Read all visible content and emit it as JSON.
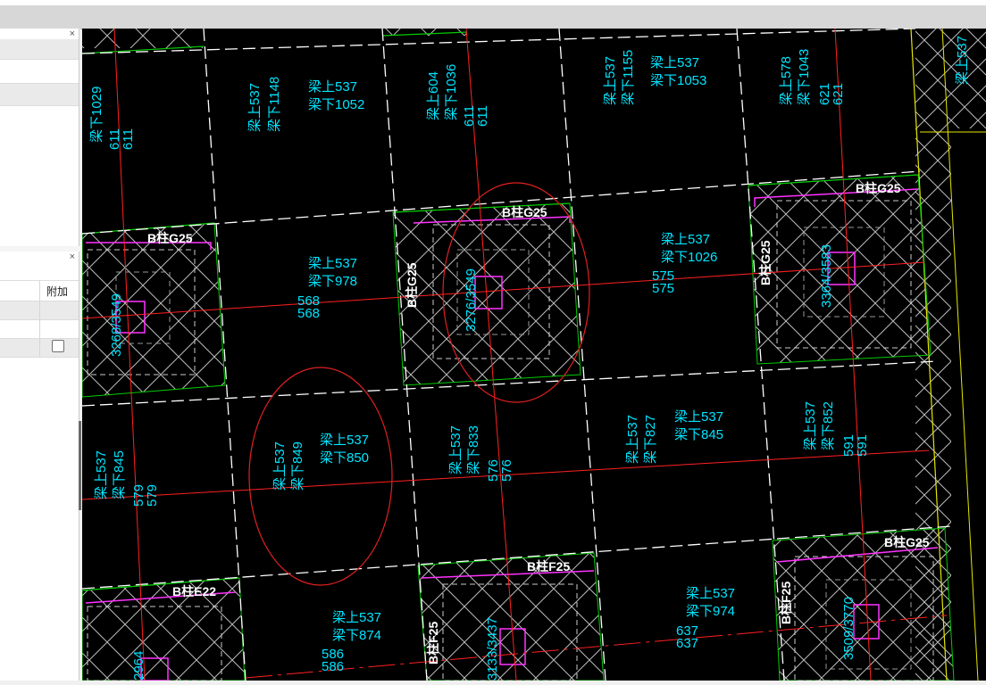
{
  "toolbar": {},
  "left_panel": {
    "panel_a_close": "×",
    "panel_b_close": "×",
    "column_header": "附加",
    "checkbox_checked": false
  },
  "drawing": {
    "beam_labels": [
      "梁上537",
      "梁下1148",
      "梁下1052",
      "梁上604",
      "梁下1036",
      "梁上537",
      "梁下1155",
      "梁上537",
      "梁下1053",
      "梁上578",
      "梁下1043",
      "梁下1029",
      "梁上537",
      "梁下978",
      "梁上537",
      "梁下1026",
      "梁上537",
      "梁下849",
      "梁上537",
      "梁下850",
      "梁上537",
      "梁下833",
      "梁上537",
      "梁下827",
      "梁上537",
      "梁下845",
      "梁上537",
      "梁下852",
      "梁上537",
      "梁下845",
      "梁上537",
      "梁下874",
      "梁上537",
      "梁下974",
      "梁上537"
    ],
    "dimension_pairs": [
      "611",
      "611",
      "611",
      "611",
      "621",
      "621",
      "568",
      "568",
      "575",
      "575",
      "579",
      "579",
      "576",
      "576",
      "591",
      "591",
      "586",
      "586",
      "637",
      "637"
    ],
    "column_labels": [
      "B柱G25",
      "B柱G25",
      "B柱G25",
      "B柱G25",
      "B柱G25",
      "B柱G25",
      "B柱G25",
      "B柱G25",
      "B柱F25",
      "B柱F25",
      "B柱G25",
      "B柱E22",
      "B柱F25",
      "B柱F25"
    ],
    "column_sizes": [
      "3268/3549",
      "3276/3549",
      "3364/3583",
      "3133/3437",
      "3509/3770",
      "2964"
    ]
  }
}
